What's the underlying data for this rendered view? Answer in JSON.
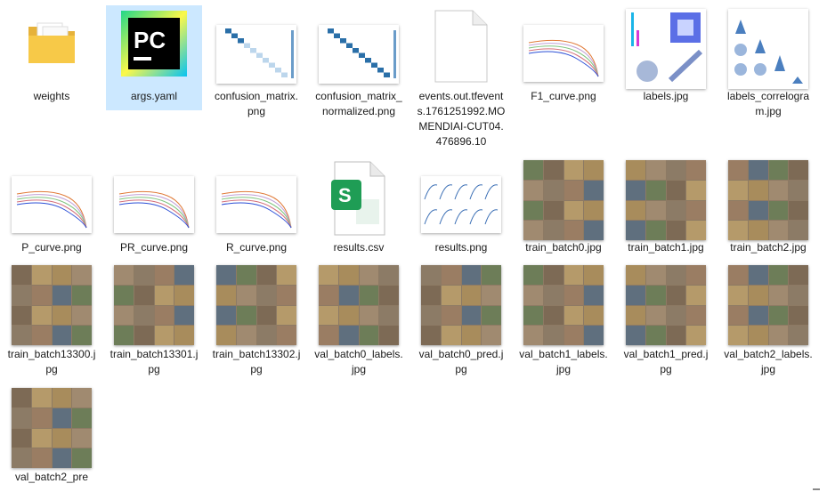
{
  "files": [
    {
      "name": "weights",
      "icon": "folder-icon"
    },
    {
      "name": "args.yaml",
      "icon": "pycharm-icon",
      "selected": true
    },
    {
      "name": "confusion_matrix.png",
      "icon": "confusion-matrix-thumbnail"
    },
    {
      "name": "confusion_matrix_normalized.png",
      "icon": "confusion-matrix-normalized-thumbnail"
    },
    {
      "name": "events.out.tfevents.1761251992.MOMENDIAI-CUT04.476896.10",
      "icon": "blank-file-icon"
    },
    {
      "name": "F1_curve.png",
      "icon": "curve-thumbnail"
    },
    {
      "name": "labels.jpg",
      "icon": "labels-thumbnail"
    },
    {
      "name": "labels_correlogram.jpg",
      "icon": "correlogram-thumbnail"
    },
    {
      "name": "P_curve.png",
      "icon": "curve-thumbnail"
    },
    {
      "name": "PR_curve.png",
      "icon": "curve-thumbnail"
    },
    {
      "name": "R_curve.png",
      "icon": "curve-thumbnail"
    },
    {
      "name": "results.csv",
      "icon": "spreadsheet-icon"
    },
    {
      "name": "results.png",
      "icon": "results-thumbnail"
    },
    {
      "name": "train_batch0.jpg",
      "icon": "photo-grid-thumbnail"
    },
    {
      "name": "train_batch1.jpg",
      "icon": "photo-grid-thumbnail"
    },
    {
      "name": "train_batch2.jpg",
      "icon": "photo-grid-thumbnail"
    },
    {
      "name": "train_batch13300.jpg",
      "icon": "photo-grid-thumbnail"
    },
    {
      "name": "train_batch13301.jpg",
      "icon": "photo-grid-thumbnail"
    },
    {
      "name": "train_batch13302.jpg",
      "icon": "photo-grid-thumbnail"
    },
    {
      "name": "val_batch0_labels.jpg",
      "icon": "photo-grid-thumbnail"
    },
    {
      "name": "val_batch0_pred.jpg",
      "icon": "photo-grid-thumbnail"
    },
    {
      "name": "val_batch1_labels.jpg",
      "icon": "photo-grid-thumbnail"
    },
    {
      "name": "val_batch1_pred.jpg",
      "icon": "photo-grid-thumbnail"
    },
    {
      "name": "val_batch2_labels.jpg",
      "icon": "photo-grid-thumbnail"
    },
    {
      "name": "val_batch2_pre",
      "icon": "photo-grid-thumbnail"
    }
  ],
  "colors": {
    "selected_bg": "#cce8ff",
    "folder": "#f7c948",
    "spreadsheet": "#1f9d55",
    "pycharm": "#21d789"
  }
}
